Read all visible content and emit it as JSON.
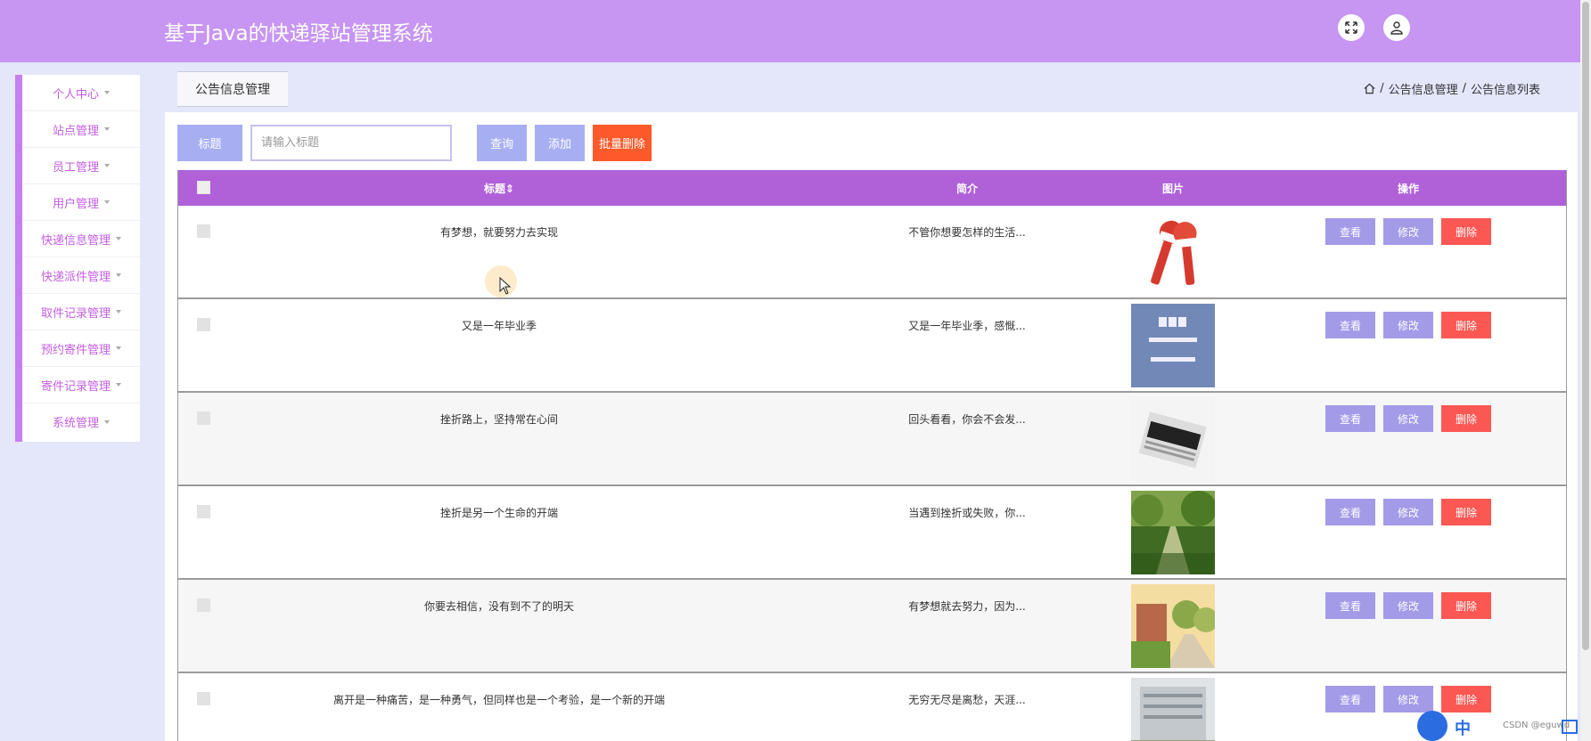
{
  "header": {
    "title": "基于Java的快递驿站管理系统"
  },
  "sidebar": {
    "items": [
      {
        "label": "个人中心"
      },
      {
        "label": "站点管理"
      },
      {
        "label": "员工管理"
      },
      {
        "label": "用户管理"
      },
      {
        "label": "快递信息管理"
      },
      {
        "label": "快递派件管理"
      },
      {
        "label": "取件记录管理"
      },
      {
        "label": "预约寄件管理"
      },
      {
        "label": "寄件记录管理"
      },
      {
        "label": "系统管理"
      }
    ]
  },
  "tab": {
    "label": "公告信息管理"
  },
  "breadcrumb": {
    "level1": "公告信息管理",
    "sep": "/",
    "level2": "公告信息列表"
  },
  "search": {
    "label": "标题",
    "placeholder": "请输入标题",
    "query_btn": "查询",
    "add_btn": "添加",
    "batch_delete_btn": "批量删除"
  },
  "table": {
    "headers": {
      "title": "标题",
      "intro": "简介",
      "image": "图片",
      "ops": "操作"
    },
    "actions": {
      "view": "查看",
      "edit": "修改",
      "delete": "删除"
    },
    "rows": [
      {
        "title": "有梦想，就要努力去实现",
        "intro": "不管你想要怎样的生活...",
        "image": "microphones-news-live"
      },
      {
        "title": "又是一年毕业季",
        "intro": "又是一年毕业季，感慨...",
        "image": "bbc-world-news"
      },
      {
        "title": "挫折路上，坚持常在心间",
        "intro": "回头看看，你会不会发...",
        "image": "newspaper-news"
      },
      {
        "title": "挫折是另一个生命的开端",
        "intro": "当遇到挫折或失败，你...",
        "image": "tree-lined-path"
      },
      {
        "title": "你要去相信，没有到不了的明天",
        "intro": "有梦想就去努力，因为...",
        "image": "campus-road"
      },
      {
        "title": "离开是一种痛苦，是一种勇气，但同样也是一个考验，是一个新的开端",
        "intro": "无穷无尽是离愁，天涯...",
        "image": "modern-building"
      }
    ]
  },
  "overlay": {
    "ime_char": "中",
    "watermark": "CSDN @eguwd"
  },
  "colors": {
    "header": "#c795f2",
    "table_head": "#b061d8",
    "button": "#a39ae8",
    "danger": "#fb5753",
    "menu_text": "#c25fe0"
  }
}
